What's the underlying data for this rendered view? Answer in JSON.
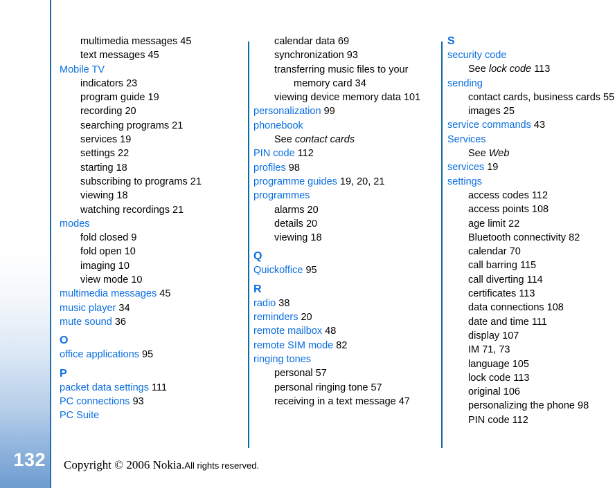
{
  "page": {
    "number": "132",
    "footer_copyright_serif": "Copyright © 2006 Nokia.",
    "footer_copyright_sans": "All rights reserved."
  },
  "columns": [
    {
      "name": "column-1",
      "entries": [
        {
          "type": "sub",
          "text": "multimedia messages",
          "page": "45"
        },
        {
          "type": "sub",
          "text": "text messages",
          "page": "45"
        },
        {
          "type": "entry",
          "text": "Mobile TV",
          "page": ""
        },
        {
          "type": "sub",
          "text": "indicators",
          "page": "23"
        },
        {
          "type": "sub",
          "text": "program guide",
          "page": "19"
        },
        {
          "type": "sub",
          "text": "recording",
          "page": "20"
        },
        {
          "type": "sub",
          "text": "searching programs",
          "page": "21"
        },
        {
          "type": "sub",
          "text": "services",
          "page": "19"
        },
        {
          "type": "sub",
          "text": "settings",
          "page": "22"
        },
        {
          "type": "sub",
          "text": "starting",
          "page": "18"
        },
        {
          "type": "sub",
          "text": "subscribing to programs",
          "page": "21"
        },
        {
          "type": "sub",
          "text": "viewing",
          "page": "18"
        },
        {
          "type": "sub",
          "text": "watching recordings",
          "page": "21"
        },
        {
          "type": "entry",
          "text": "modes",
          "page": ""
        },
        {
          "type": "sub",
          "text": "fold closed",
          "page": "9"
        },
        {
          "type": "sub",
          "text": "fold open",
          "page": "10"
        },
        {
          "type": "sub",
          "text": "imaging",
          "page": "10"
        },
        {
          "type": "sub",
          "text": "view mode",
          "page": "10"
        },
        {
          "type": "entry",
          "text": "multimedia messages",
          "page": "45"
        },
        {
          "type": "entry",
          "text": "music player",
          "page": "34"
        },
        {
          "type": "entry",
          "text": "mute sound",
          "page": "36"
        },
        {
          "type": "letter",
          "text": "O"
        },
        {
          "type": "entry",
          "text": "office applications",
          "page": "95"
        },
        {
          "type": "letter",
          "text": "P"
        },
        {
          "type": "entry",
          "text": "packet data settings",
          "page": "111"
        },
        {
          "type": "entry",
          "text": "PC connections",
          "page": "93"
        },
        {
          "type": "entry",
          "text": "PC Suite",
          "page": ""
        }
      ]
    },
    {
      "name": "column-2",
      "entries": [
        {
          "type": "sub",
          "text": "calendar data",
          "page": "69"
        },
        {
          "type": "sub",
          "text": "synchronization",
          "page": "93"
        },
        {
          "type": "sub-wrap",
          "text": "transferring music files to your",
          "cont": "memory card",
          "page": "34"
        },
        {
          "type": "sub",
          "text": "viewing device memory data",
          "page": "101"
        },
        {
          "type": "entry",
          "text": "personalization",
          "page": "99"
        },
        {
          "type": "entry",
          "text": "phonebook",
          "page": ""
        },
        {
          "type": "see",
          "see_label": "See",
          "ref": "contact cards",
          "page": ""
        },
        {
          "type": "entry",
          "text": "PIN code",
          "page": "112"
        },
        {
          "type": "entry",
          "text": "profiles",
          "page": "98"
        },
        {
          "type": "entry",
          "text": "programme guides",
          "page": "19, 20, 21"
        },
        {
          "type": "entry",
          "text": "programmes",
          "page": ""
        },
        {
          "type": "sub",
          "text": "alarms",
          "page": "20"
        },
        {
          "type": "sub",
          "text": "details",
          "page": "20"
        },
        {
          "type": "sub",
          "text": "viewing",
          "page": "18"
        },
        {
          "type": "letter",
          "text": "Q"
        },
        {
          "type": "entry",
          "text": "Quickoffice",
          "page": "95"
        },
        {
          "type": "letter",
          "text": "R"
        },
        {
          "type": "entry",
          "text": "radio",
          "page": "38"
        },
        {
          "type": "entry",
          "text": "reminders",
          "page": "20"
        },
        {
          "type": "entry",
          "text": "remote mailbox",
          "page": "48"
        },
        {
          "type": "entry",
          "text": "remote SIM mode",
          "page": "82"
        },
        {
          "type": "entry",
          "text": "ringing tones",
          "page": ""
        },
        {
          "type": "sub",
          "text": "personal",
          "page": "57"
        },
        {
          "type": "sub",
          "text": "personal ringing tone",
          "page": "57"
        },
        {
          "type": "sub",
          "text": "receiving in a text message",
          "page": "47"
        }
      ]
    },
    {
      "name": "column-3",
      "entries": [
        {
          "type": "letter",
          "text": "S"
        },
        {
          "type": "entry",
          "text": "security code",
          "page": ""
        },
        {
          "type": "see",
          "see_label": "See",
          "ref": "lock code",
          "page": "113"
        },
        {
          "type": "entry",
          "text": "sending",
          "page": ""
        },
        {
          "type": "sub",
          "text": "contact cards, business cards",
          "page": "55"
        },
        {
          "type": "sub",
          "text": "images",
          "page": "25"
        },
        {
          "type": "entry",
          "text": "service commands",
          "page": "43"
        },
        {
          "type": "entry",
          "text": "Services",
          "page": ""
        },
        {
          "type": "see",
          "see_label": "See",
          "ref": "Web",
          "page": ""
        },
        {
          "type": "entry",
          "text": "services",
          "page": "19"
        },
        {
          "type": "entry",
          "text": "settings",
          "page": ""
        },
        {
          "type": "sub",
          "text": "access codes",
          "page": "112"
        },
        {
          "type": "sub",
          "text": "access points",
          "page": "108"
        },
        {
          "type": "sub",
          "text": "age limit",
          "page": "22"
        },
        {
          "type": "sub",
          "text": "Bluetooth connectivity",
          "page": "82"
        },
        {
          "type": "sub",
          "text": "calendar",
          "page": "70"
        },
        {
          "type": "sub",
          "text": "call barring",
          "page": "115"
        },
        {
          "type": "sub",
          "text": "call diverting",
          "page": "114"
        },
        {
          "type": "sub",
          "text": "certificates",
          "page": "113"
        },
        {
          "type": "sub",
          "text": "data connections",
          "page": "108"
        },
        {
          "type": "sub",
          "text": "date and time",
          "page": "111"
        },
        {
          "type": "sub",
          "text": "display",
          "page": "107"
        },
        {
          "type": "sub",
          "text": "IM",
          "page": "71, 73"
        },
        {
          "type": "sub",
          "text": "language",
          "page": "105"
        },
        {
          "type": "sub",
          "text": "lock code",
          "page": "113"
        },
        {
          "type": "sub",
          "text": "original",
          "page": "106"
        },
        {
          "type": "sub",
          "text": "personalizing the phone",
          "page": "98"
        },
        {
          "type": "sub",
          "text": "PIN code",
          "page": "112"
        }
      ]
    }
  ],
  "colors": {
    "entry_blue": "#0a6ee0",
    "divider_blue": "#0b6aa8",
    "strip_blue": "#6d9cd0"
  }
}
